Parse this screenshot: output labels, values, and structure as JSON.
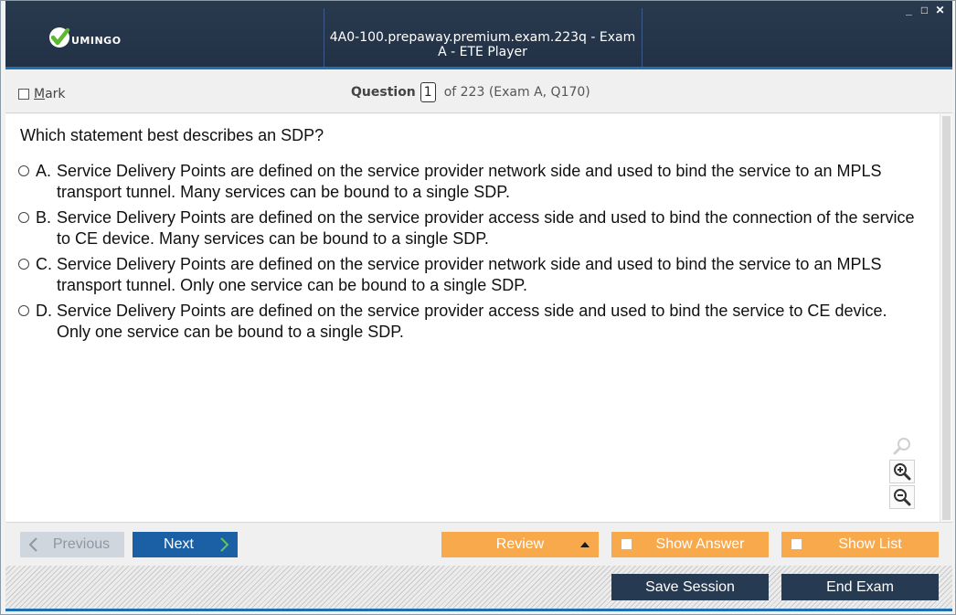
{
  "window": {
    "title": "4A0-100.prepaway.premium.exam.223q - Exam A - ETE Player",
    "logo_text": "UMINGO",
    "controls": {
      "minimize": "_",
      "maximize": "□",
      "close": "✕"
    }
  },
  "header": {
    "mark_label_first": "M",
    "mark_label_rest": "ark",
    "question_label": "Question",
    "question_number": "1",
    "question_of": "of 223 (Exam A, Q170)"
  },
  "question": {
    "text": "Which statement best describes an SDP?",
    "answers": [
      {
        "letter": "A.",
        "text": "Service Delivery Points are defined on the service provider network side and used to bind the service to an MPLS transport tunnel. Many services can be bound to a single SDP."
      },
      {
        "letter": "B.",
        "text": "Service Delivery Points are defined on the service provider access side and used to bind the connection of the service to CE device. Many services can be bound to a single SDP."
      },
      {
        "letter": "C.",
        "text": "Service Delivery Points are defined on the service provider network side and used to bind the service to an MPLS transport tunnel. Only one service can be bound to a single SDP."
      },
      {
        "letter": "D.",
        "text": "Service Delivery Points are defined on the service provider access side and used to bind the service to CE device. Only one service can be bound to a single SDP."
      }
    ]
  },
  "zoom": {
    "icons": [
      "search-icon",
      "zoom-in-icon",
      "zoom-out-icon"
    ]
  },
  "nav": {
    "previous": "Previous",
    "next": "Next",
    "review": "Review",
    "show_answer": "Show Answer",
    "show_list": "Show List"
  },
  "footer": {
    "save_session": "Save Session",
    "end_exam": "End Exam"
  },
  "colors": {
    "titlebar": "#223145",
    "accent_blue": "#1f6fb3",
    "next_button": "#1b5fa5",
    "orange_button": "#f7a94b",
    "dark_button": "#263a52",
    "logo_green": "#5cb82e"
  }
}
